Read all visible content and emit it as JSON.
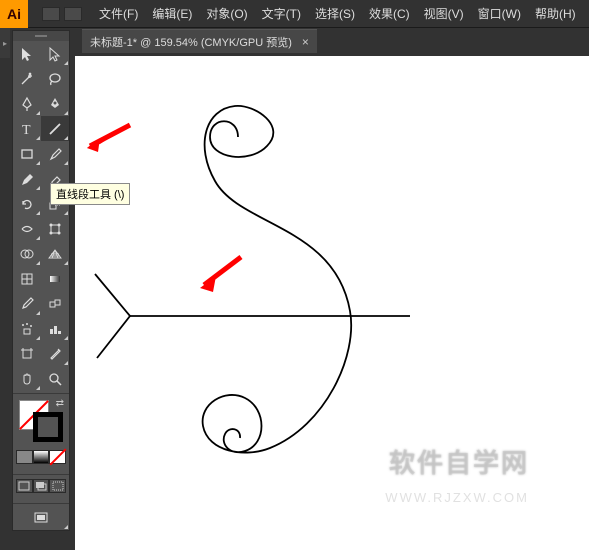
{
  "app": {
    "icon_text": "Ai"
  },
  "menu": {
    "items": [
      {
        "label": "文件(F)"
      },
      {
        "label": "编辑(E)"
      },
      {
        "label": "对象(O)"
      },
      {
        "label": "文字(T)"
      },
      {
        "label": "选择(S)"
      },
      {
        "label": "效果(C)"
      },
      {
        "label": "视图(V)"
      },
      {
        "label": "窗口(W)"
      },
      {
        "label": "帮助(H)"
      }
    ]
  },
  "doc_tab": {
    "title": "未标题-1* @ 159.54% (CMYK/GPU 预览)",
    "close": "×"
  },
  "tooltip": {
    "text": "直线段工具 (\\)"
  },
  "tools": {
    "rows": [
      [
        "selection",
        "direct-selection"
      ],
      [
        "magic-wand",
        "lasso"
      ],
      [
        "pen",
        "curvature"
      ],
      [
        "type",
        "line-segment"
      ],
      [
        "rectangle",
        "paintbrush"
      ],
      [
        "shaper",
        "eraser"
      ],
      [
        "rotate",
        "scale"
      ],
      [
        "width",
        "free-transform"
      ],
      [
        "shape-builder",
        "perspective"
      ],
      [
        "mesh",
        "gradient"
      ],
      [
        "eyedropper",
        "blend"
      ],
      [
        "symbol-sprayer",
        "graph"
      ],
      [
        "artboard",
        "slice"
      ],
      [
        "hand",
        "zoom"
      ]
    ],
    "selected": "line-segment"
  },
  "watermark": {
    "main": "软件自学网",
    "sub": "WWW.RJZXW.COM"
  }
}
